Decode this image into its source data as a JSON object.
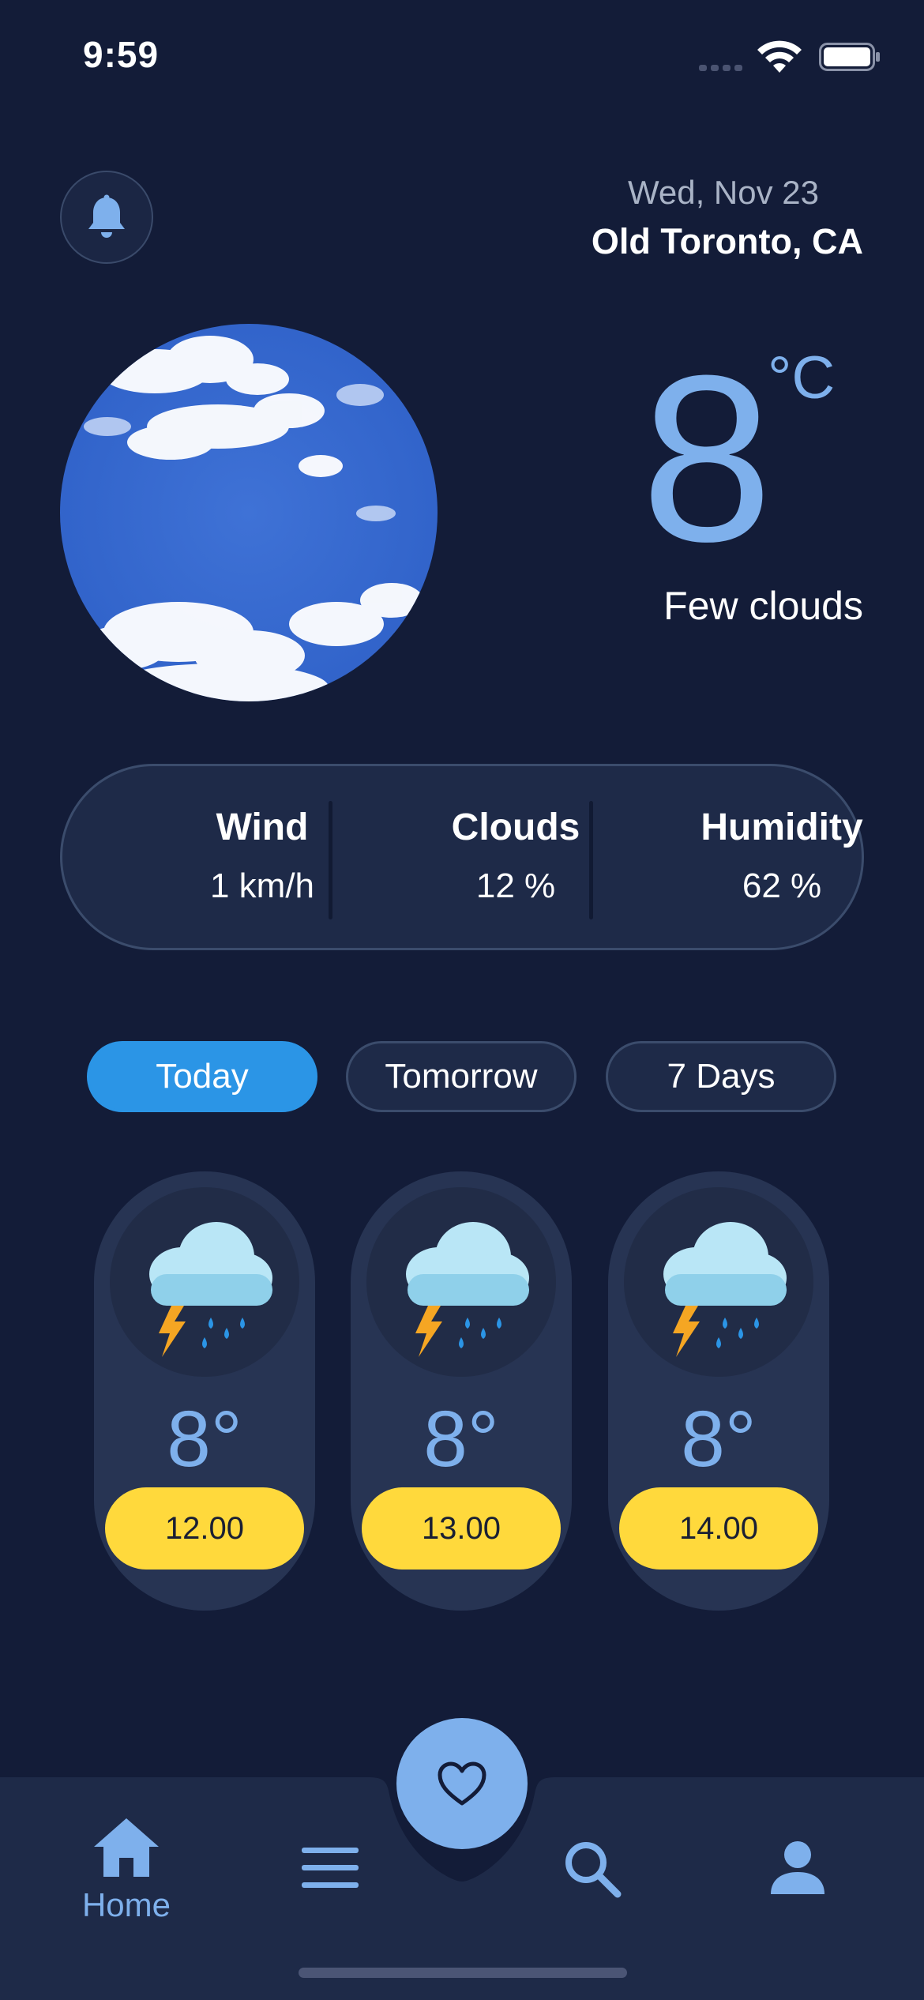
{
  "status_bar": {
    "time": "9:59"
  },
  "header": {
    "date": "Wed, Nov 23",
    "location": "Old Toronto, CA"
  },
  "current": {
    "temperature": "8",
    "unit": "°C",
    "condition": "Few clouds"
  },
  "stats": [
    {
      "label": "Wind",
      "value": "1 km/h"
    },
    {
      "label": "Clouds",
      "value": "12 %"
    },
    {
      "label": "Humidity",
      "value": "62 %"
    }
  ],
  "tabs": [
    {
      "label": "Today",
      "active": true
    },
    {
      "label": "Tomorrow",
      "active": false
    },
    {
      "label": "7 Days",
      "active": false
    }
  ],
  "hourly": [
    {
      "icon": "thunderstorm-icon",
      "temp": "8°",
      "time": "12.00"
    },
    {
      "icon": "thunderstorm-icon",
      "temp": "8°",
      "time": "13.00"
    },
    {
      "icon": "thunderstorm-icon",
      "temp": "8°",
      "time": "14.00"
    }
  ],
  "nav": {
    "home_label": "Home"
  },
  "colors": {
    "background": "#131c38",
    "accent": "#7eb0ec",
    "active_tab": "#2b95e6",
    "time_badge": "#ffd93c"
  }
}
